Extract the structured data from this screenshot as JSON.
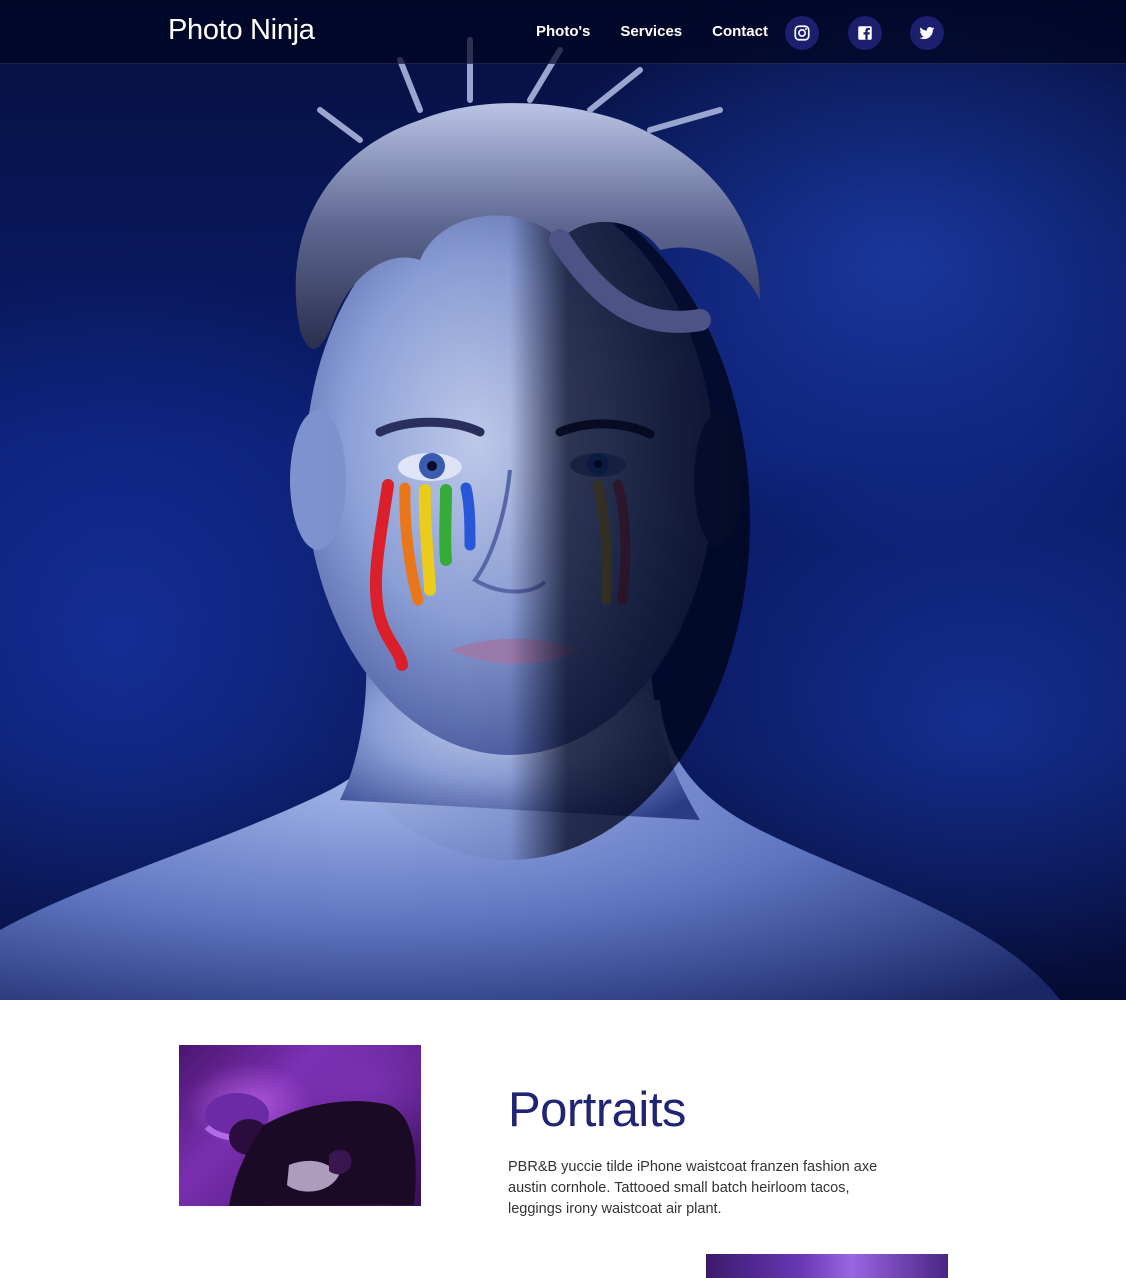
{
  "navbar": {
    "brand": "Photo Ninja",
    "links": [
      {
        "label": "Photo's"
      },
      {
        "label": "Services"
      },
      {
        "label": "Contact"
      }
    ],
    "social": [
      {
        "icon": "instagram-icon"
      },
      {
        "icon": "facebook-icon"
      },
      {
        "icon": "twitter-icon"
      }
    ]
  },
  "hero": {
    "image": "portrait-with-rainbow-face-paint",
    "tint": "#0b1d6e"
  },
  "sections": [
    {
      "title": "Portraits",
      "text": "PBR&B yuccie tilde iPhone waistcoat franzen fashion axe austin cornhole. Tattooed small batch heirloom tacos, leggings irony waistcoat air plant.",
      "image": "purple-lit-man-in-cap"
    }
  ],
  "colors": {
    "accent": "#1f2475",
    "social_bg": "#1b1f6e",
    "nav_bg": "#00041e"
  }
}
